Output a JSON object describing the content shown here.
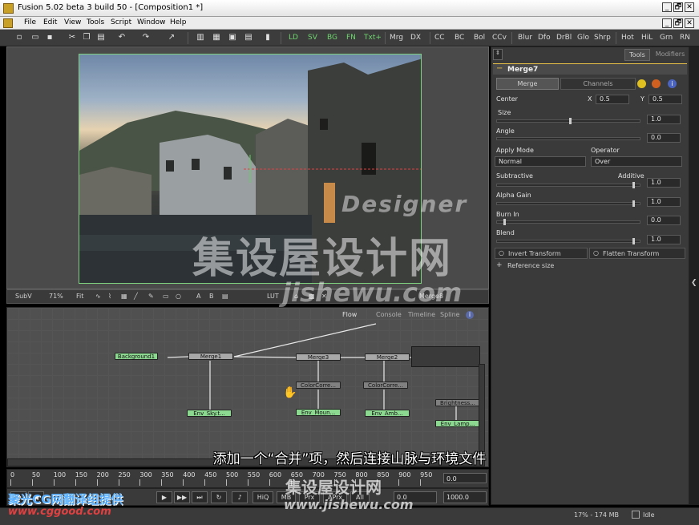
{
  "window": {
    "title": "Fusion 5.02 beta 3 build 50 - [Composition1 *]",
    "controls": [
      "_",
      "🗗",
      "✕"
    ]
  },
  "menu": [
    "File",
    "Edit",
    "View",
    "Tools",
    "Script",
    "Window",
    "Help"
  ],
  "toolbar": {
    "tools": [
      "LD",
      "SV",
      "BG",
      "FN",
      "Txt+",
      "Mrg",
      "DX",
      "CC",
      "BC",
      "Bol",
      "CCv",
      "Blur",
      "Dfo",
      "DrBl",
      "Glo",
      "Shrp",
      "Hot",
      "HiL",
      "Grn",
      "RN"
    ],
    "tool_colors": {
      "green": [
        "LD",
        "SV",
        "BG",
        "FN",
        "Txt+"
      ]
    }
  },
  "viewer": {
    "subview": "SubV",
    "zoom": "71%",
    "fit": "Fit",
    "lut": "LUT",
    "node_label": "Merge8"
  },
  "flow": {
    "tabs": [
      "Flow",
      "Console",
      "Timeline",
      "Spline"
    ],
    "nodes": {
      "background1": "Background1",
      "merge1": "Merge1",
      "merge3": "Merge3",
      "merge2": "Merge2",
      "colorcorrector1": "ColorCorre...",
      "colorcorrector2": "ColorCorre...",
      "env_sky": "Env_Sky.t...",
      "env_mountain": "Env_Moun...",
      "env_ambient": "Env_Amb...",
      "brightness": "Brightness...",
      "env_lamp": "Env_Lamp..."
    }
  },
  "timeline": {
    "ticks": [
      "0",
      "50",
      "100",
      "150",
      "200",
      "250",
      "300",
      "350",
      "400",
      "450",
      "500",
      "550",
      "600",
      "650",
      "700",
      "750",
      "800",
      "850",
      "900",
      "950"
    ],
    "current_time": "0.0"
  },
  "transport": {
    "hiq": "HiQ",
    "mb": "MB",
    "prx": "Prx",
    "aprx": "APrx",
    "all": "All",
    "start": "0.0",
    "end": "1000.0"
  },
  "status": {
    "memory": "17% - 174 MB",
    "state": "Idle"
  },
  "inspector": {
    "tabs": [
      "Tools",
      "Modifiers"
    ],
    "tool_name": "Merge7",
    "subtabs": [
      "Merge",
      "Channels"
    ],
    "center_label": "Center",
    "x_label": "X",
    "x_value": "0.5",
    "y_label": "Y",
    "y_value": "0.5",
    "size_label": "Size",
    "size_value": "1.0",
    "angle_label": "Angle",
    "angle_value": "0.0",
    "apply_mode_label": "Apply Mode",
    "apply_mode_value": "Normal",
    "operator_label": "Operator",
    "operator_value": "Over",
    "subtractive_label": "Subtractive",
    "additive_label": "Additive",
    "additive_value": "1.0",
    "alpha_gain_label": "Alpha Gain",
    "alpha_gain_value": "1.0",
    "burn_in_label": "Burn In",
    "burn_in_value": "0.0",
    "blend_label": "Blend",
    "blend_value": "1.0",
    "invert_transform": "Invert Transform",
    "flatten_transform": "Flatten Transform",
    "reference_size": "Reference size"
  },
  "overlay": {
    "subtitle": "添加一个“合并”项，然后连接山脉与环境文件",
    "watermark_en": "Designer",
    "watermark_cn": "集设屋设计网",
    "watermark_url": "jishewu.com",
    "watermark_cn_small": "集设屋设计网",
    "watermark_url_small": "www.jishewu.com",
    "credit_cn": "聚光CG网翻译组提供",
    "credit_url": "www.cggood.com"
  },
  "colors": {
    "panel": "#3a3a3a",
    "flow_bg": "#505050",
    "node_green": "#8cd890",
    "accent_yellow": "#e8c048",
    "frame_green": "#7fd07f"
  }
}
